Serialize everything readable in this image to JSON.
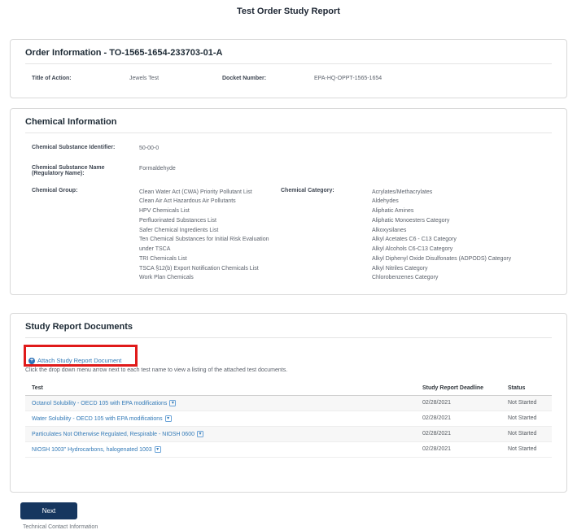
{
  "page": {
    "title": "Test Order Study Report"
  },
  "order_info": {
    "heading": "Order Information - TO-1565-1654-233703-01-A",
    "title_of_action": {
      "label": "Title of Action:",
      "value": "Jewels Test"
    },
    "docket_number": {
      "label": "Docket Number:",
      "value": "EPA-HQ-OPPT-1565-1654"
    }
  },
  "chemical_info": {
    "heading": "Chemical Information",
    "identifier": {
      "label": "Chemical Substance Identifier:",
      "value": "50-00-0"
    },
    "name": {
      "label": "Chemical Substance Name (Regulatory Name):",
      "value": "Formaldehyde"
    },
    "group": {
      "label": "Chemical Group:",
      "items": [
        "Clean Water Act (CWA) Priority Pollutant List",
        "Clean Air Act Hazardous Air Pollutants",
        "HPV Chemicals List",
        "Perfluorinated Substances List",
        "Safer Chemical Ingredients List",
        "Ten Chemical Substances for Initial Risk Evaluation under TSCA",
        "TRI Chemicals List",
        "TSCA §12(b) Export Notification Chemicals List",
        "Work Plan Chemicals"
      ]
    },
    "category": {
      "label": "Chemical Category:",
      "items": [
        "Acrylates/Methacrylates",
        "Aldehydes",
        "Aliphatic Amines",
        "Aliphatic Monoesters Category",
        "Alkoxysilanes",
        "Alkyl Acetates C6 - C13 Category",
        "Alkyl Alcohols C6-C13 Category",
        "Alkyl Diphenyl Oxide Disulfonates (ADPODS) Category",
        "Alkyl Nitriles Category",
        "Chlorobenzenes Category"
      ]
    }
  },
  "study_report": {
    "heading": "Study Report Documents",
    "attach": {
      "label": "Attach Study Report Document",
      "icon": "plus-circle-icon"
    },
    "instruction": "Click the drop down menu arrow next to each test name to view a listing of the attached test documents.",
    "table": {
      "headers": [
        "Test",
        "Study Report Deadline",
        "Status"
      ],
      "row_icon": "caret-square-down-icon",
      "rows": [
        {
          "test": "Octanol Solubility - OECD 105 with EPA modifications",
          "deadline": "02/28/2021",
          "status": "Not Started"
        },
        {
          "test": "Water Solubility - OECD 105 with EPA modifications",
          "deadline": "02/28/2021",
          "status": "Not Started"
        },
        {
          "test": "Particulates Not Otherwise Regulated, Respirable - NIOSH 0600",
          "deadline": "02/28/2021",
          "status": "Not Started"
        },
        {
          "test": "NIOSH 1003\" Hydrocarbons, halogenated 1003",
          "deadline": "02/28/2021",
          "status": "Not Started"
        }
      ]
    }
  },
  "footer": {
    "next_label": "Next",
    "technical_contact_label": "Technical Contact Information"
  },
  "colors": {
    "link_blue": "#337ab7",
    "button_navy": "#16365f",
    "annotation_red": "#e01a1a",
    "heading_dark": "#1d2a35"
  }
}
